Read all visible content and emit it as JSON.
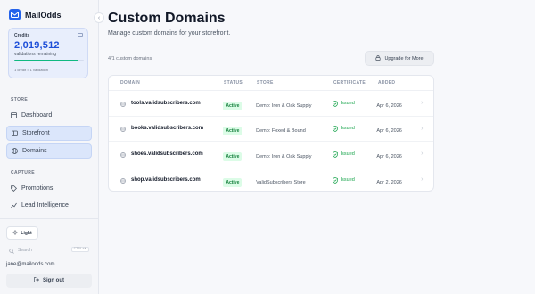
{
  "brand": {
    "name": "MailOdds"
  },
  "credits": {
    "label": "Credits",
    "value": "2,019,512",
    "sub": "validations remaining",
    "rate": "1 credit = 1 validation",
    "progress": 0.92
  },
  "sidebar": {
    "store_title": "STORE",
    "store_items": [
      {
        "label": "Dashboard",
        "icon": "dashboard-icon"
      },
      {
        "label": "Storefront",
        "icon": "storefront-icon"
      },
      {
        "label": "Domains",
        "icon": "globe-icon"
      }
    ],
    "capture_title": "CAPTURE",
    "capture_items": [
      {
        "label": "Promotions",
        "icon": "tag-icon"
      },
      {
        "label": "Lead Intelligence",
        "icon": "chart-icon"
      }
    ],
    "theme_label": "Light",
    "search_label": "Search",
    "search_shortcut": "CTRL+K",
    "user_email": "jane@mailodds.com",
    "signout_label": "Sign out"
  },
  "main": {
    "title": "Custom Domains",
    "subtitle": "Manage custom domains for your storefront.",
    "count_label": "4/1 custom domains",
    "upgrade_label": "Upgrade for More",
    "columns": [
      "DOMAIN",
      "STATUS",
      "STORE",
      "CERTIFICATE",
      "ADDED"
    ],
    "rows": [
      {
        "domain": "tools.validsubscribers.com",
        "status": "Active",
        "store": "Demo: Iron & Oak Supply",
        "certificate": "Issued",
        "added": "Apr 6, 2026"
      },
      {
        "domain": "books.validsubscribers.com",
        "status": "Active",
        "store": "Demo: Foxed & Bound",
        "certificate": "Issued",
        "added": "Apr 6, 2026"
      },
      {
        "domain": "shoes.validsubscribers.com",
        "status": "Active",
        "store": "Demo: Iron & Oak Supply",
        "certificate": "Issued",
        "added": "Apr 6, 2026"
      },
      {
        "domain": "shop.validsubscribers.com",
        "status": "Active",
        "store": "ValidSubscribers Store",
        "certificate": "Issued",
        "added": "Apr 2, 2026"
      }
    ]
  },
  "colors": {
    "accent": "#2563eb",
    "success": "#16a34a"
  }
}
